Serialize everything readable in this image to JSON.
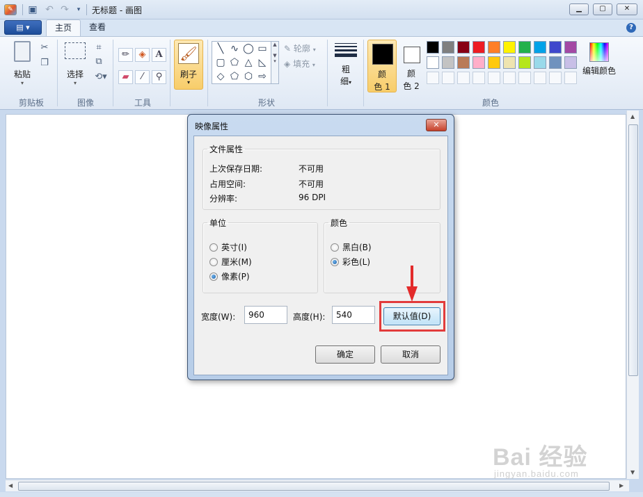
{
  "window": {
    "title": "无标题 - 画图",
    "app_icon": "paint-app-icon",
    "minimize": "minimize-icon",
    "maximize": "maximize-icon",
    "close": "close-icon"
  },
  "quick_access": [
    "save-icon",
    "undo-icon",
    "redo-icon",
    "customize-dropdown-icon"
  ],
  "tabs": [
    {
      "label": "主页",
      "active": true
    },
    {
      "label": "查看",
      "active": false
    }
  ],
  "ribbon": {
    "clipboard": {
      "paste_label": "粘贴",
      "group_label": "剪贴板"
    },
    "image": {
      "select_label": "选择",
      "group_label": "图像"
    },
    "tools": {
      "group_label": "工具"
    },
    "brushes": {
      "label": "刷子"
    },
    "shapes": {
      "outline_label": "轮廓",
      "fill_label": "填充",
      "group_label": "形状"
    },
    "size": {
      "label_line1": "粗",
      "label_line2": "细"
    },
    "colors": {
      "color1_line1": "颜",
      "color1_line2": "色 1",
      "color2_line1": "颜",
      "color2_line2": "色 2",
      "color1_value": "#000000",
      "color2_value": "#ffffff",
      "edit_colors_label": "编辑颜色",
      "group_label": "颜色",
      "palette_row1": [
        "#000000",
        "#7f7f7f",
        "#880015",
        "#ed1c24",
        "#ff7f27",
        "#fff200",
        "#22b14c",
        "#00a2e8",
        "#3f48cc",
        "#a349a4"
      ],
      "palette_row2": [
        "#ffffff",
        "#c3c3c3",
        "#b97a57",
        "#ffaec9",
        "#ffc90e",
        "#efe4b0",
        "#b5e61d",
        "#99d9ea",
        "#7092be",
        "#c8bfe7"
      ]
    }
  },
  "dialog": {
    "title": "映像属性",
    "file_props": {
      "legend": "文件属性",
      "rows": [
        {
          "label": "上次保存日期:",
          "value": "不可用"
        },
        {
          "label": "占用空间:",
          "value": "不可用"
        },
        {
          "label": "分辨率:",
          "value": "96 DPI"
        }
      ]
    },
    "units": {
      "legend": "单位",
      "options": [
        {
          "label": "英寸(I)",
          "checked": false
        },
        {
          "label": "厘米(M)",
          "checked": false
        },
        {
          "label": "像素(P)",
          "checked": true
        }
      ]
    },
    "color_mode": {
      "legend": "颜色",
      "options": [
        {
          "label": "黑白(B)",
          "checked": false
        },
        {
          "label": "彩色(L)",
          "checked": true
        }
      ]
    },
    "width_label": "宽度(W):",
    "width_value": "960",
    "height_label": "高度(H):",
    "height_value": "540",
    "default_button": "默认值(D)",
    "ok_button": "确定",
    "cancel_button": "取消"
  },
  "watermark": {
    "logo": "Bai 经验",
    "url": "jingyan.baidu.com"
  }
}
